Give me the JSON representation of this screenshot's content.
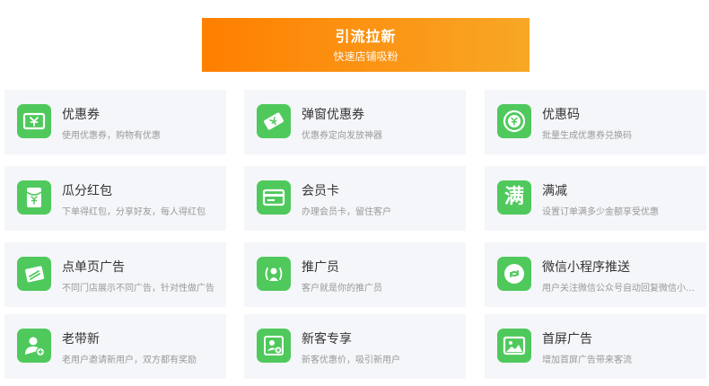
{
  "banner": {
    "title": "引流拉新",
    "subtitle": "快速店铺吸粉"
  },
  "colors": {
    "banner_start": "#ff7f00",
    "banner_end": "#f8a726",
    "icon_green": "#4fc95c",
    "card_bg": "#f5f6f9"
  },
  "cards": [
    {
      "title": "优惠券",
      "desc": "使用优惠券，购物有优惠",
      "icon": "coupon-yen-icon"
    },
    {
      "title": "弹窗优惠券",
      "desc": "优惠券定向发放神器",
      "icon": "popup-coupon-icon"
    },
    {
      "title": "优惠码",
      "desc": "批量生成优惠券兑换码",
      "icon": "coupon-code-icon"
    },
    {
      "title": "瓜分红包",
      "desc": "下单得红包，分享好友，每人得红包",
      "icon": "red-envelope-icon"
    },
    {
      "title": "会员卡",
      "desc": "办理会员卡，留住客户",
      "icon": "member-card-icon"
    },
    {
      "title": "满减",
      "desc": "设置订单满多少金额享受优惠",
      "icon": "full-reduction-icon",
      "glyph": "满"
    },
    {
      "title": "点单页广告",
      "desc": "不同门店展示不同广告，针对性做广告",
      "icon": "order-page-ad-icon"
    },
    {
      "title": "推广员",
      "desc": "客户就是你的推广员",
      "icon": "promoter-icon"
    },
    {
      "title": "微信小程序推送",
      "desc": "用户关注微信公众号自动回复微信小程序",
      "icon": "mini-program-icon"
    },
    {
      "title": "老带新",
      "desc": "老用户邀请新用户，双方都有奖励",
      "icon": "refer-friend-icon"
    },
    {
      "title": "新客专享",
      "desc": "新客优惠价，吸引新用户",
      "icon": "new-customer-icon"
    },
    {
      "title": "首屏广告",
      "desc": "增加首屏广告带来客流",
      "icon": "splash-ad-icon"
    }
  ]
}
